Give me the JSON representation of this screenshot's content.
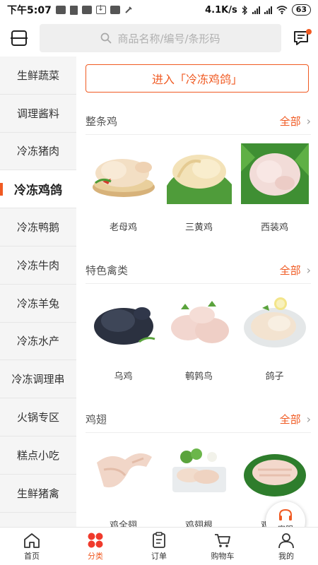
{
  "status_bar": {
    "time": "下午5:07",
    "network_speed": "4.1K/s",
    "battery": "63",
    "icons": [
      "message-icon",
      "trash-icon",
      "message-icon",
      "download-icon",
      "message-icon",
      "phone-icon",
      "bluetooth-icon",
      "signal-icon",
      "signal-icon",
      "wifi-icon",
      "battery-icon"
    ]
  },
  "header": {
    "search_placeholder": "商品名称/编号/条形码",
    "scan_icon": "scan-icon",
    "message_icon": "message-icon"
  },
  "sidebar": {
    "items": [
      {
        "label": "生鲜蔬菜"
      },
      {
        "label": "调理酱料"
      },
      {
        "label": "冷冻猪肉"
      },
      {
        "label": "冷冻鸡鸽",
        "active": true
      },
      {
        "label": "冷冻鸭鹅"
      },
      {
        "label": "冷冻牛肉"
      },
      {
        "label": "冷冻羊兔"
      },
      {
        "label": "冷冻水产"
      },
      {
        "label": "冷冻调理串"
      },
      {
        "label": "火锅专区"
      },
      {
        "label": "糕点小吃"
      },
      {
        "label": "生鲜猪禽"
      },
      {
        "label": ""
      }
    ]
  },
  "main": {
    "enter_button": "进入「冷冻鸡鸽」",
    "sections": [
      {
        "title": "整条鸡",
        "all_label": "全部",
        "products": [
          {
            "name": "老母鸡"
          },
          {
            "name": "三黄鸡"
          },
          {
            "name": "西装鸡"
          }
        ]
      },
      {
        "title": "特色禽类",
        "all_label": "全部",
        "products": [
          {
            "name": "乌鸡"
          },
          {
            "name": "鹌鹑鸟"
          },
          {
            "name": "鸽子"
          }
        ]
      },
      {
        "title": "鸡翅",
        "all_label": "全部",
        "products": [
          {
            "name": "鸡全翅"
          },
          {
            "name": "鸡翅根"
          },
          {
            "name": "鸡翅中"
          }
        ]
      }
    ]
  },
  "float_service": {
    "label": "客服",
    "icon": "headset-icon"
  },
  "tabbar": {
    "tabs": [
      {
        "label": "首页",
        "icon": "home-icon"
      },
      {
        "label": "分类",
        "icon": "category-icon",
        "active": true
      },
      {
        "label": "订单",
        "icon": "order-icon"
      },
      {
        "label": "购物车",
        "icon": "cart-icon"
      },
      {
        "label": "我的",
        "icon": "user-icon"
      }
    ]
  },
  "colors": {
    "accent": "#f05a22",
    "sidebar_bg": "#f5f5f5",
    "search_bg": "#efefef",
    "text": "#333333"
  }
}
